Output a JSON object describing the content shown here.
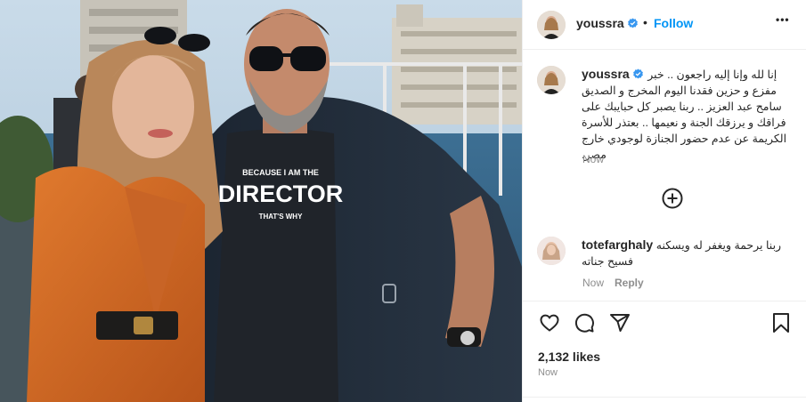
{
  "post": {
    "username": "youssra",
    "follow_label": "Follow",
    "more_label": "•••",
    "caption": "إنا لله وإنا إليه راجعون .. خبر مفزع و حزين فقدنا اليوم المخرج و الصديق سامح عبد العزيز .. ربنا يصبر كل حبايبك على فراقك و يرزقك الجنة و نعيمها .. بعتذر للأسرة الكريمة عن عدم حضور الجنازة لوجودي خارج مصر.",
    "caption_time": "Now",
    "likes": "2,132 likes",
    "post_time": "Now"
  },
  "photo": {
    "shirt_line1": "BECAUSE I AM THE",
    "shirt_line2": "DIRECTOR",
    "shirt_line3": "THAT'S WHY"
  },
  "comment": {
    "username": "totefarghaly",
    "text": "ربنا يرحمة ويغفر له ويسكنه فسيح جناته",
    "time": "Now",
    "reply_label": "Reply"
  },
  "icons": {
    "more_comments": "plus-circle-icon",
    "like": "heart-icon",
    "comment": "comment-icon",
    "share": "share-icon",
    "save": "bookmark-icon"
  },
  "colors": {
    "follow_blue": "#0095f6",
    "verified_blue": "#3897f0",
    "muted": "#8e8e8e",
    "text": "#262626"
  }
}
